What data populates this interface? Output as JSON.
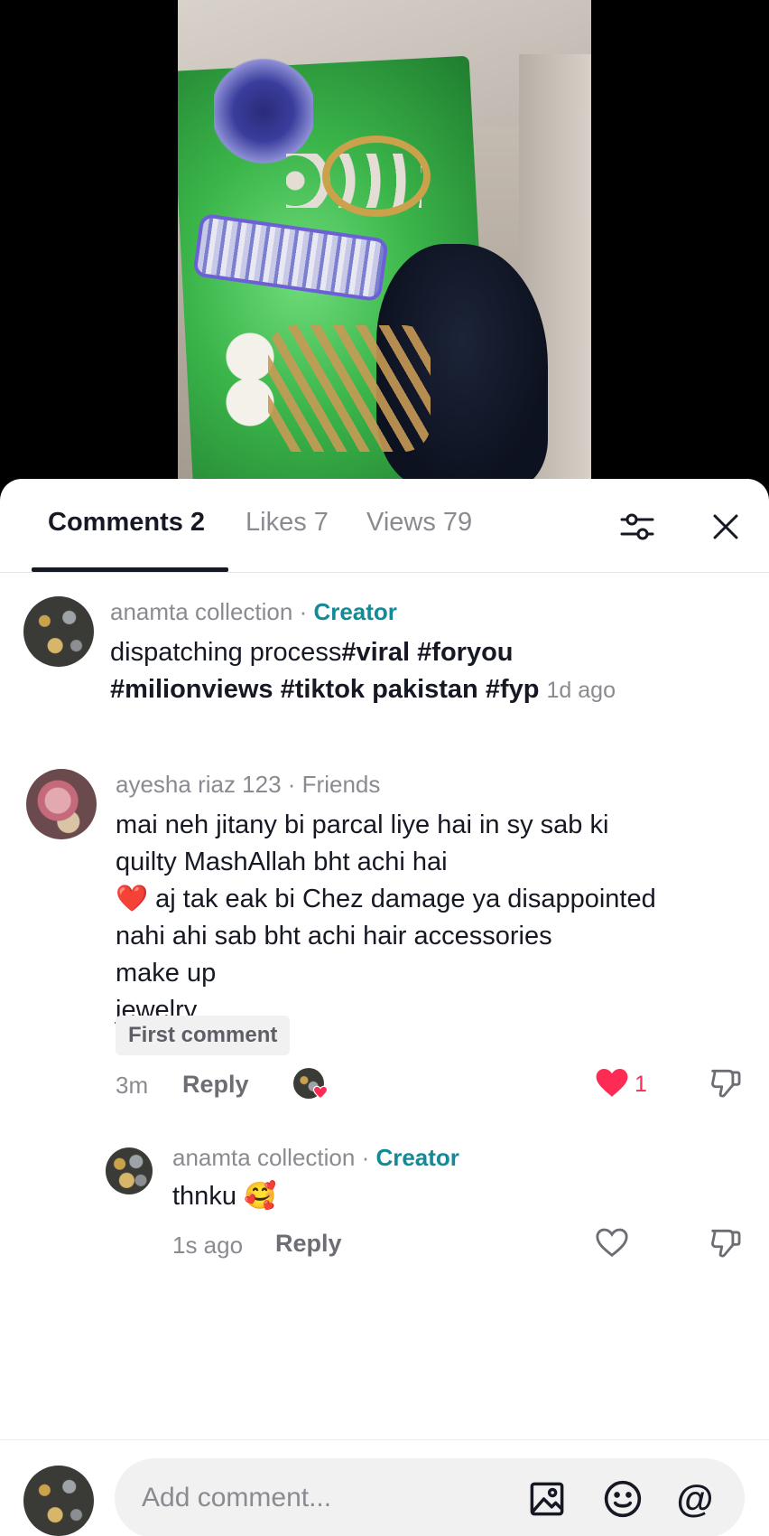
{
  "tabs": {
    "comments": "Comments 2",
    "likes": "Likes 7",
    "views": "Views 79"
  },
  "icons": {
    "filter": "sliders-icon",
    "close": "close-icon",
    "like": "heart-icon",
    "dislike": "thumbs-down-icon",
    "image": "image-icon",
    "emoji": "emoji-icon",
    "mention": "at-icon"
  },
  "colors": {
    "creator": "#138a95",
    "heart": "#fe2c55"
  },
  "comments": [
    {
      "author": "anamta collection",
      "sep": " · ",
      "role": "Creator",
      "text_plain": "dispatching process",
      "text_tags_line1": "#viral #foryou",
      "text_tags_line2": "#milionviews #tiktok pakistan #fyp",
      "time": "1d ago"
    },
    {
      "author": "ayesha riaz 123",
      "sep": " · ",
      "role": "Friends",
      "lines": [
        "mai neh jitany bi parcal liye hai in sy sab ki",
        "quilty MashAllah bht achi hai",
        "❤️ aj tak eak bi Chez damage ya disappointed",
        "nahi ahi sab bht achi hair accessories",
        "make up",
        "jewelry"
      ],
      "badge": "First comment",
      "time": "3m",
      "reply": "Reply",
      "likes": "1"
    },
    {
      "author": "anamta collection",
      "sep": " · ",
      "role": "Creator",
      "text": "thnku 🥰",
      "time": "1s ago",
      "reply": "Reply"
    }
  ],
  "input": {
    "placeholder": "Add comment...",
    "mention": "@"
  }
}
